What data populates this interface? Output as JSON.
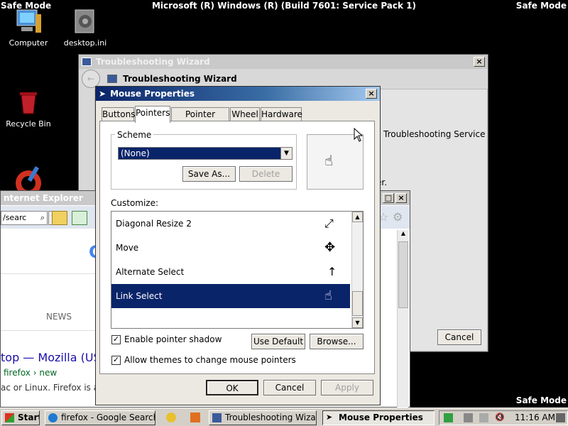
{
  "desktop": {
    "safe_mode_label": "Safe Mode",
    "build_text": "Microsoft (R) Windows (R) (Build 7601: Service Pack 1)",
    "icons": [
      {
        "label": "Computer"
      },
      {
        "label": "desktop.ini"
      },
      {
        "label": "Recycle Bin"
      }
    ]
  },
  "troubleshooting": {
    "title": "Troubleshooting Wizard",
    "heading": "Troubleshooting Wizard",
    "service_text": "Troubleshooting Service",
    "partial_text": "er.",
    "cancel_label": "Cancel"
  },
  "ie": {
    "title": "nternet Explorer",
    "address_value": "/searc",
    "news_label": "NEWS",
    "result_title": "top — Mozilla (US",
    "result_url": "firefox › new",
    "result_snippet": "ac or Linux. Firefox is a"
  },
  "mouse": {
    "title": "Mouse Properties",
    "tabs": [
      "Buttons",
      "Pointers",
      "Pointer Options",
      "Wheel",
      "Hardware"
    ],
    "scheme_label": "Scheme",
    "scheme_value": "(None)",
    "save_as_label": "Save As...",
    "delete_label": "Delete",
    "customize_label": "Customize:",
    "cursor_rows": [
      {
        "label": "Diagonal Resize 2",
        "icon": "diagonal-resize-icon"
      },
      {
        "label": "Move",
        "icon": "move-icon"
      },
      {
        "label": "Alternate Select",
        "icon": "alternate-select-icon"
      },
      {
        "label": "Link Select",
        "icon": "link-select-icon",
        "selected": true
      }
    ],
    "enable_shadow_label": "Enable pointer shadow",
    "enable_shadow_checked": true,
    "allow_themes_label": "Allow themes to change mouse pointers",
    "allow_themes_checked": true,
    "use_default_label": "Use Default",
    "browse_label": "Browse...",
    "ok_label": "OK",
    "cancel_label": "Cancel",
    "apply_label": "Apply"
  },
  "taskbar": {
    "start_label": "Start",
    "items": [
      {
        "label": "firefox - Google Search -..."
      },
      {
        "label": "Troubleshooting Wizard"
      },
      {
        "label": "Mouse Properties"
      }
    ],
    "clock": "11:16 AM"
  }
}
